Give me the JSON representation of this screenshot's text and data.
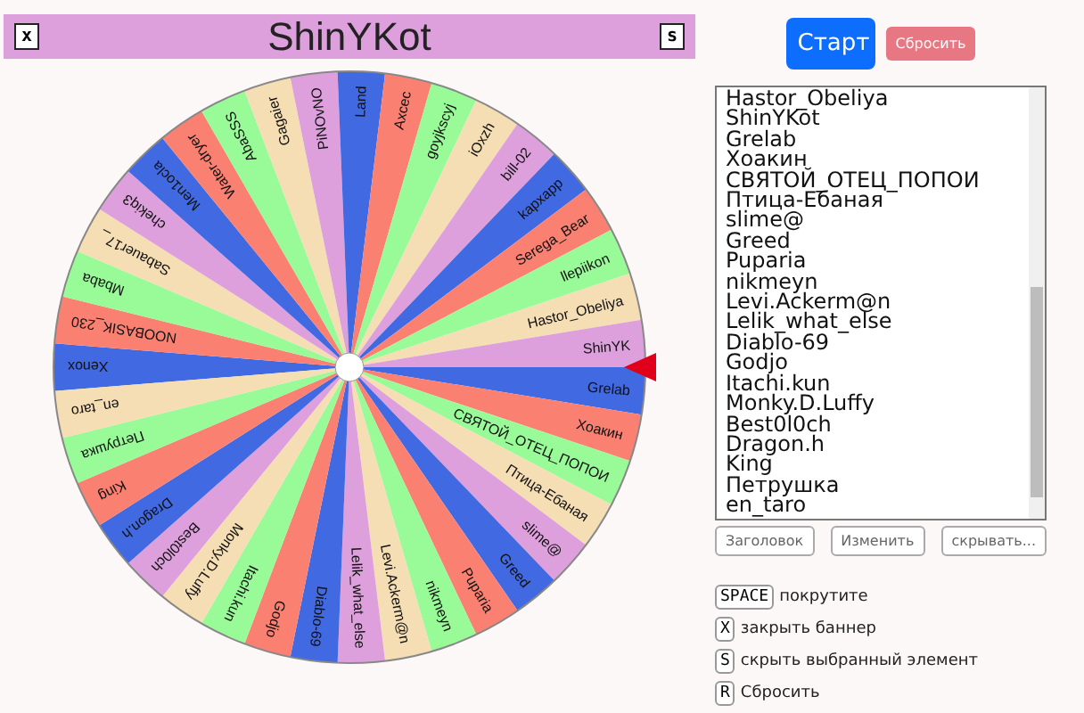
{
  "header": {
    "left_key": "x",
    "title": "ShinYKot",
    "right_key": "s"
  },
  "wheel": {
    "segments": [
      {
        "label": "Xenox"
      },
      {
        "label": "NOOBASIK_230"
      },
      {
        "label": "Mbaba"
      },
      {
        "label": "Sabauer17_"
      },
      {
        "label": "chekiq3"
      },
      {
        "label": "Men1ocla"
      },
      {
        "label": "Water-dryer"
      },
      {
        "label": "AbaSSS"
      },
      {
        "label": "Gagaier"
      },
      {
        "label": "PiNOvNO"
      },
      {
        "label": "Land"
      },
      {
        "label": "Axcec"
      },
      {
        "label": "goyjkscyj"
      },
      {
        "label": "iOxzh"
      },
      {
        "label": "bill-02"
      },
      {
        "label": "kapxapp"
      },
      {
        "label": "Serega_Bear"
      },
      {
        "label": "llepiikon"
      },
      {
        "label": "Hastor_Obeliya"
      },
      {
        "label": "ShinYK"
      },
      {
        "label": "Grelab"
      },
      {
        "label": "Хоакин"
      },
      {
        "label": "СВЯТОЙ_ОТЕЦ_ПОПОИ"
      },
      {
        "label": "Птица-Ебаная"
      },
      {
        "label": "slime@"
      },
      {
        "label": "Greed"
      },
      {
        "label": "Puparia"
      },
      {
        "label": "nikmeyn"
      },
      {
        "label": "Levi.Ackerm@n"
      },
      {
        "label": "Lelik_what_else"
      },
      {
        "label": "Diablo-69"
      },
      {
        "label": "Godjo"
      },
      {
        "label": "Itachi.kun"
      },
      {
        "label": "Monky.D.Luffy"
      },
      {
        "label": "Best0l0ch"
      },
      {
        "label": "Dragon.h"
      },
      {
        "label": "King"
      },
      {
        "label": "Петрушка"
      },
      {
        "label": "en_taro"
      }
    ]
  },
  "controls": {
    "start": "Старт",
    "reset": {
      "label": "Сбросить",
      "disabled": true
    }
  },
  "names_list": {
    "entries": [
      "Hastor_Obeliya",
      "ShinYKot",
      "Grelab",
      "Хоакин",
      "СВЯТОЙ_ОТЕЦ_ПОПОИ",
      "Птица-Ебаная",
      "slime@",
      "Greed",
      "Puparia",
      "nikmeyn",
      "Levi.Ackerm@n",
      "Lelik_what_else",
      "Diablo-69",
      "Godjo",
      "Itachi.kun",
      "Monky.D.Luffy",
      "Best0l0ch",
      "Dragon.h",
      "King",
      "Петрушка",
      "en_taro"
    ]
  },
  "list_buttons": [
    "Заголовок",
    "Изменить",
    "скрывать..."
  ],
  "shortcuts": [
    {
      "key": "SPACE",
      "text": "покрутите"
    },
    {
      "key": "X",
      "text": "закрыть баннер"
    },
    {
      "key": "S",
      "text": "скрыть выбранный элемент"
    },
    {
      "key": "R",
      "text": "Сбросить"
    }
  ]
}
